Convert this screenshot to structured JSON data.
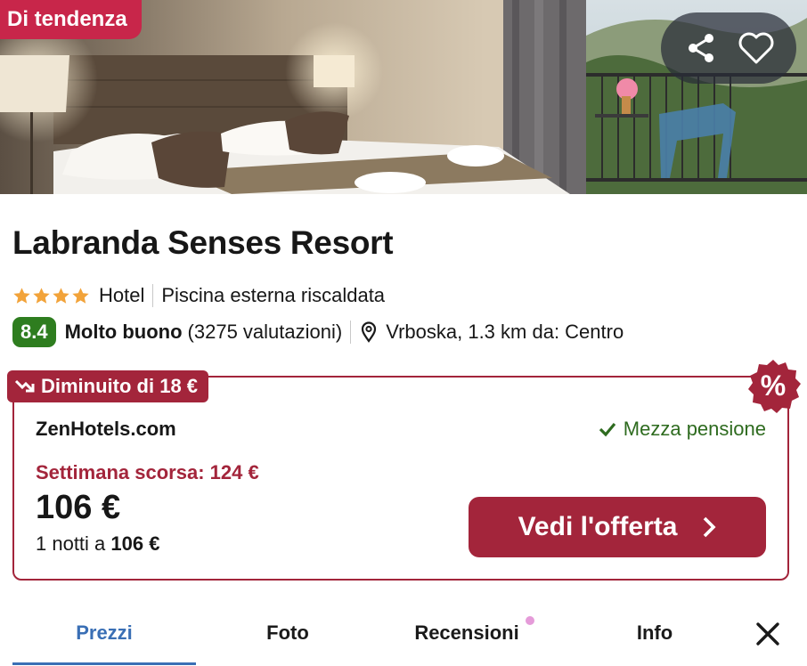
{
  "hero": {
    "badge": "Di tendenza",
    "share_icon": "share-icon",
    "favorite_icon": "heart-icon"
  },
  "hotel": {
    "name": "Labranda Senses Resort",
    "star_count": 4,
    "type": "Hotel",
    "feature": "Piscina esterna riscaldata",
    "score": "8.4",
    "rating_label": "Molto buono",
    "reviews_count": "(3275 valutazioni)",
    "location": "Vrboska, 1.3 km da: Centro"
  },
  "deal": {
    "drop_badge": "Diminuito di 18 €",
    "percent_badge": "%",
    "provider": "ZenHotels.com",
    "board": "Mezza pensione",
    "last_week": "Settimana scorsa: 124 €",
    "price": "106 €",
    "nights_prefix": "1 notti a ",
    "nights_price": "106 €",
    "cta_label": "Vedi l'offerta"
  },
  "tabs": [
    {
      "label": "Prezzi",
      "active": true
    },
    {
      "label": "Foto",
      "active": false
    },
    {
      "label": "Recensioni",
      "active": false
    },
    {
      "label": "Info",
      "active": false
    }
  ],
  "colors": {
    "brand_red": "#a3253b",
    "trend_red": "#c8264a",
    "score_green": "#2e7d1f",
    "active_tab_blue": "#3a6fb5",
    "star_orange": "#f2a33a"
  }
}
